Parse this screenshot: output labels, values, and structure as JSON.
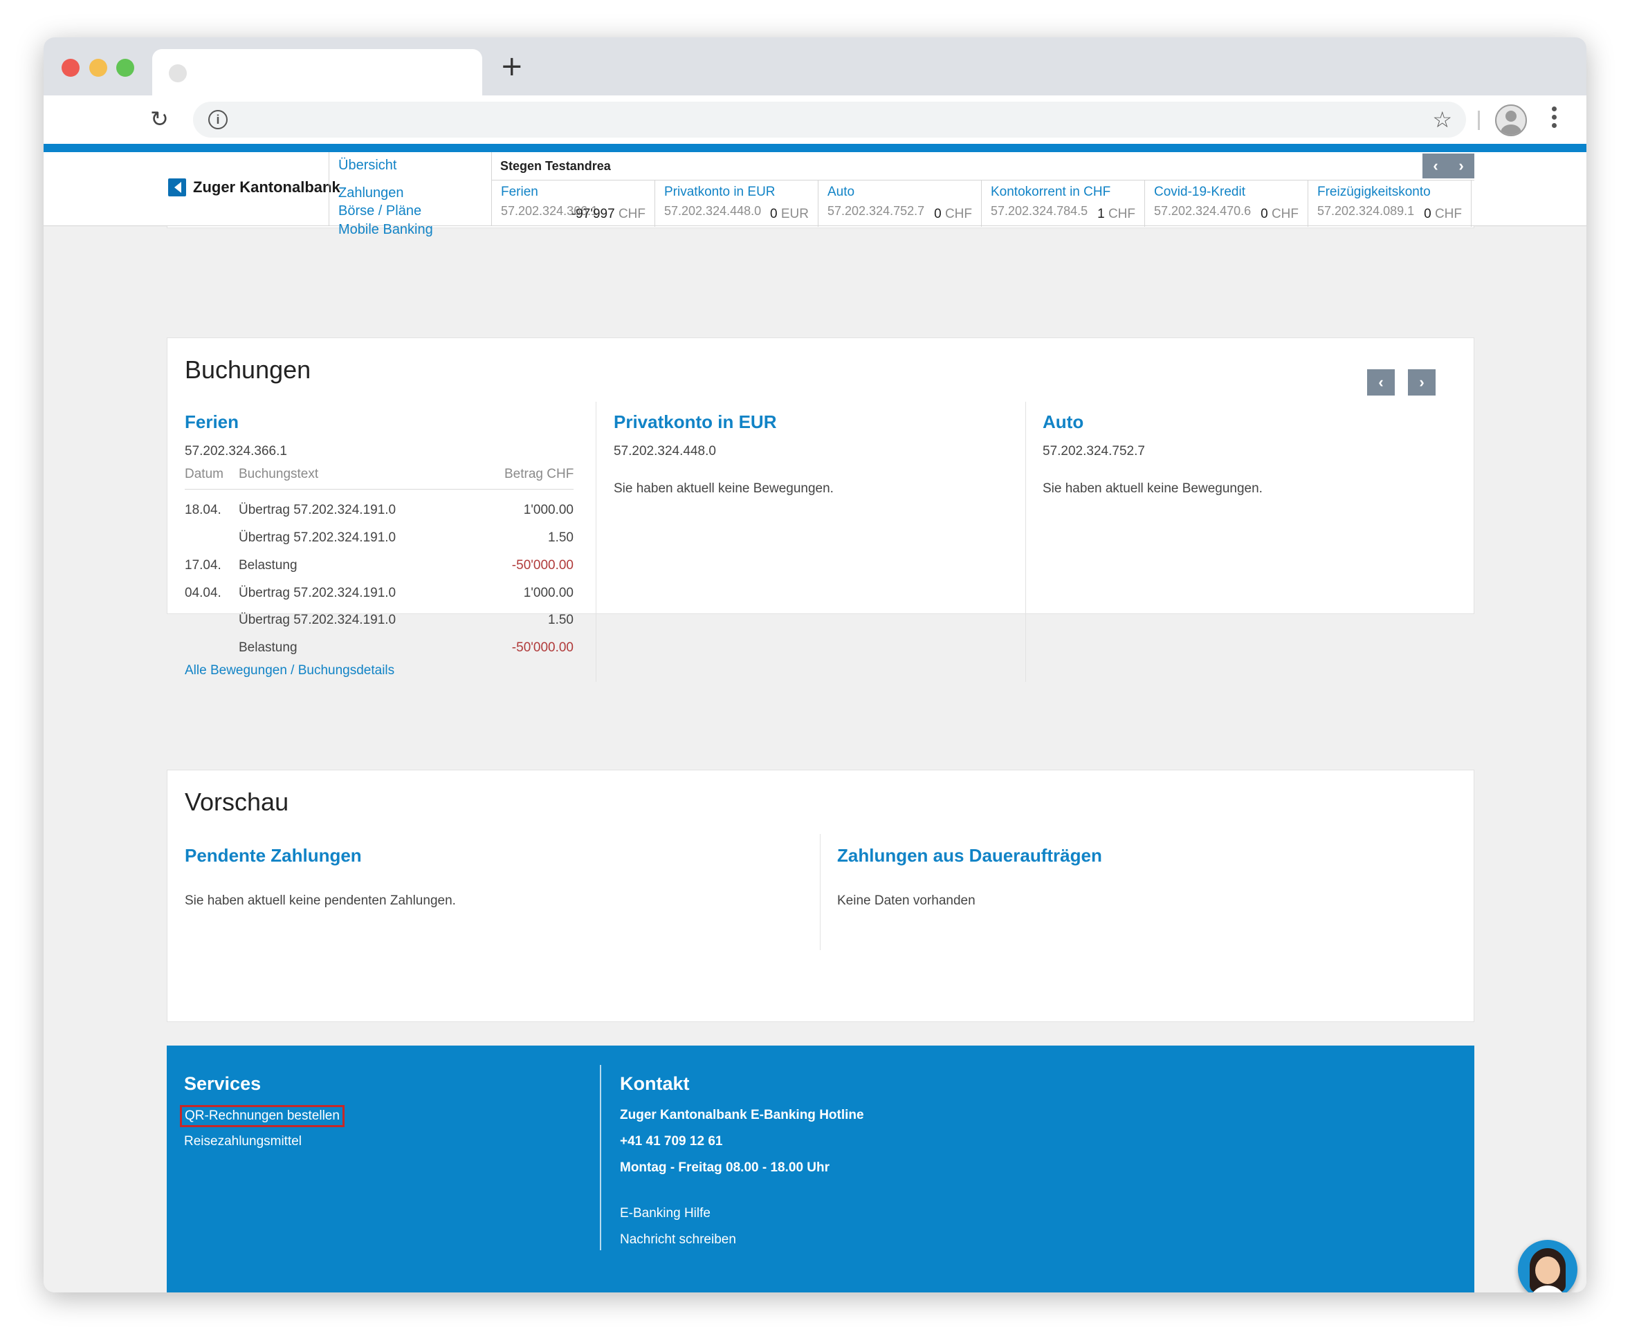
{
  "browser": {
    "new_tab_symbol": "+",
    "reload_symbol": "↻",
    "info_symbol": "i",
    "bookmark_symbol": "☆"
  },
  "bank": {
    "name": "Zuger Kantonalbank"
  },
  "main_nav": [
    {
      "label": "Übersicht"
    },
    {
      "label": "Zahlungen"
    },
    {
      "label": "Börse / Pläne"
    },
    {
      "label": "Mobile Banking"
    }
  ],
  "accounts_strip": {
    "owner": "Stegen Testandrea",
    "prev_symbol": "‹",
    "next_symbol": "›",
    "accounts": [
      {
        "name": "Ferien",
        "iban": "57.202.324.366.1",
        "amount": "-97'997",
        "currency": "CHF"
      },
      {
        "name": "Privatkonto in EUR",
        "iban": "57.202.324.448.0",
        "amount": "0",
        "currency": "EUR"
      },
      {
        "name": "Auto",
        "iban": "57.202.324.752.7",
        "amount": "0",
        "currency": "CHF"
      },
      {
        "name": "Kontokorrent in CHF",
        "iban": "57.202.324.784.5",
        "amount": "1",
        "currency": "CHF"
      },
      {
        "name": "Covid-19-Kredit",
        "iban": "57.202.324.470.6",
        "amount": "0",
        "currency": "CHF"
      },
      {
        "name": "Freizügigkeitskonto",
        "iban": "57.202.324.089.1",
        "amount": "0",
        "currency": "CHF"
      }
    ]
  },
  "buchungen": {
    "title": "Buchungen",
    "prev_symbol": "‹",
    "next_symbol": "›",
    "ferien": {
      "name": "Ferien",
      "iban": "57.202.324.366.1",
      "col_date": "Datum",
      "col_text": "Buchungstext",
      "col_amount": "Betrag CHF",
      "rows": [
        {
          "date": "18.04.",
          "text": "Übertrag 57.202.324.191.0",
          "amount": "1'000.00"
        },
        {
          "date": "",
          "text": "Übertrag 57.202.324.191.0",
          "amount": "1.50"
        },
        {
          "date": "17.04.",
          "text": "Belastung",
          "amount": "-50'000.00"
        },
        {
          "date": "04.04.",
          "text": "Übertrag 57.202.324.191.0",
          "amount": "1'000.00"
        },
        {
          "date": "",
          "text": "Übertrag 57.202.324.191.0",
          "amount": "1.50"
        },
        {
          "date": "",
          "text": "Belastung",
          "amount": "-50'000.00"
        }
      ],
      "all_link": "Alle Bewegungen / Buchungsdetails"
    },
    "privatkonto": {
      "name": "Privatkonto in EUR",
      "iban": "57.202.324.448.0",
      "empty": "Sie haben aktuell keine Bewegungen."
    },
    "auto": {
      "name": "Auto",
      "iban": "57.202.324.752.7",
      "empty": "Sie haben aktuell keine Bewegungen."
    }
  },
  "vorschau": {
    "title": "Vorschau",
    "pending_title": "Pendente Zahlungen",
    "pending_empty": "Sie haben aktuell keine pendenten Zahlungen.",
    "standing_title": "Zahlungen aus Daueraufträgen",
    "standing_empty": "Keine Daten vorhanden"
  },
  "footer": {
    "services_title": "Services",
    "services_links": [
      "QR-Rechnungen bestellen",
      "Reisezahlungsmittel"
    ],
    "contact_title": "Kontakt",
    "hotline_name": "Zuger Kantonalbank E-Banking Hotline",
    "phone": "+41 41 709 12 61",
    "hours": "Montag - Freitag 08.00 - 18.00 Uhr",
    "help_link": "E-Banking Hilfe",
    "message_link": "Nachricht schreiben"
  },
  "colors": {
    "brand_blue": "#0a84c8",
    "link_blue": "#1183c6",
    "negative_red": "#b03a3a",
    "highlight_red": "#c62828"
  }
}
